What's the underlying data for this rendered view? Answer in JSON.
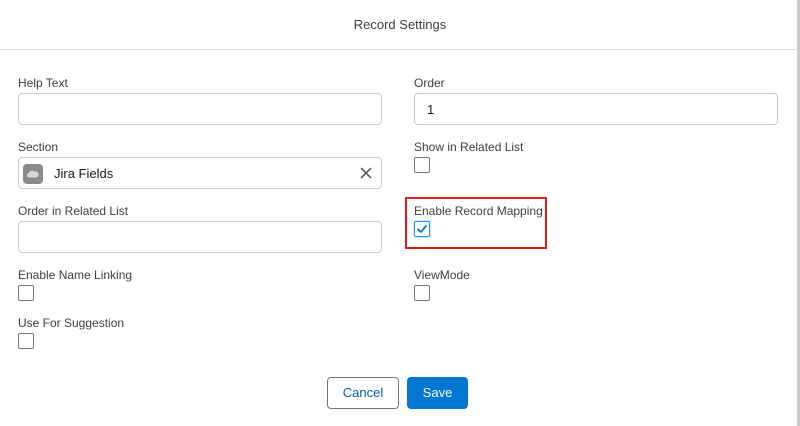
{
  "modal": {
    "title": "Record Settings"
  },
  "fields": {
    "help_text": {
      "label": "Help Text",
      "value": ""
    },
    "order": {
      "label": "Order",
      "value": "1"
    },
    "section": {
      "label": "Section",
      "value": "Jira Fields",
      "icon": "salesforce-cloud-icon"
    },
    "show_in_related_list": {
      "label": "Show in Related List",
      "checked": false
    },
    "order_in_related_list": {
      "label": "Order in Related List",
      "value": ""
    },
    "enable_record_mapping": {
      "label": "Enable Record Mapping",
      "checked": true
    },
    "enable_name_linking": {
      "label": "Enable Name Linking",
      "checked": false
    },
    "view_mode": {
      "label": "ViewMode",
      "checked": false
    },
    "use_for_suggestion": {
      "label": "Use For Suggestion",
      "checked": false
    }
  },
  "buttons": {
    "cancel": "Cancel",
    "save": "Save"
  },
  "colors": {
    "brand": "#0176d3",
    "highlight": "#e41b1b",
    "check": "#0176d3"
  }
}
